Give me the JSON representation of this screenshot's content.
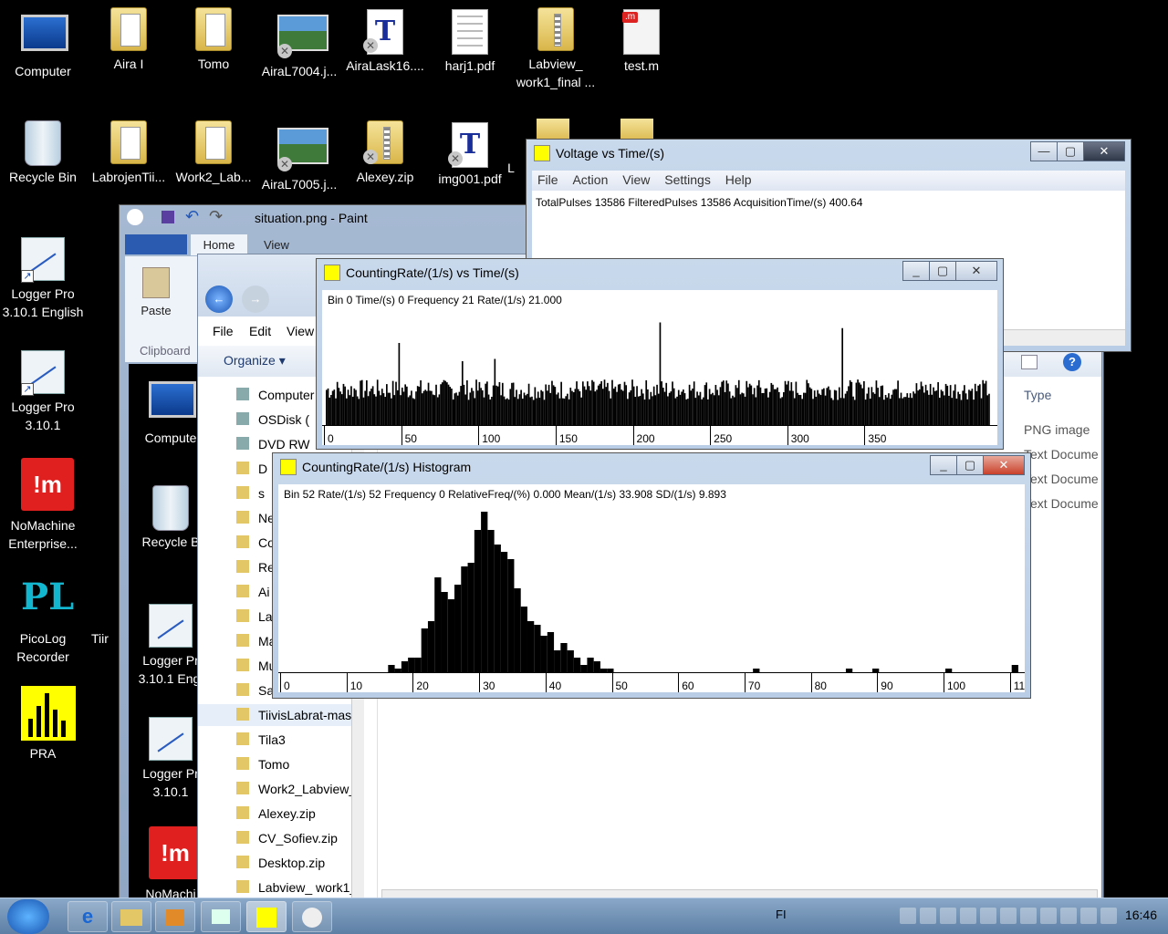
{
  "desktop": {
    "row1": [
      "Computer",
      "Aira I",
      "Tomo",
      "AiraL7004.j...",
      "AiraLask16....",
      "harj1.pdf",
      "Labview_ work1_final ...",
      "test.m"
    ],
    "row2": [
      "Recycle Bin",
      "LabrojenTii...",
      "Work2_Lab...",
      "AiraL7005.j...",
      "Alexey.zip",
      "img001.pdf",
      "L"
    ],
    "left": [
      "Logger Pro 3.10.1 English",
      "Logger Pro 3.10.1",
      "NoMachine Enterprise...",
      "PicoLog Recorder",
      "PRA"
    ],
    "mfile_tag": ".m",
    "nomachine_glyph": "!m",
    "picolog_glyph": "PL"
  },
  "paint": {
    "title": "situation.png - Paint",
    "tabs": [
      "Home",
      "View"
    ],
    "paste": "Paste",
    "clipboard": "Clipboard"
  },
  "explorer": {
    "menu": [
      "File",
      "Edit",
      "View"
    ],
    "organize": "Organize",
    "nav": [
      "Computer",
      "OSDisk (",
      "DVD RW",
      "D",
      "s",
      "Ne",
      "Co",
      "Re",
      "Ai",
      "La",
      "Ma",
      "Mu",
      "Sa",
      "TiivisLabrat-maste",
      "Tila3",
      "Tomo",
      "Work2_Labview_S",
      "Alexey.zip",
      "CV_Sofiev.zip",
      "Desktop.zip",
      "Labview_ work1_f"
    ],
    "type_header": "Type",
    "types": [
      "PNG image",
      "Text Docume",
      "Text Docume",
      "Text Docume"
    ],
    "bg_icons": [
      "Compute",
      "Recycle B",
      "Logger Pr 3.10.1 Engl",
      "Logger Pr 3.10.1",
      "NoMachi",
      "Tiir"
    ]
  },
  "voltage_window": {
    "title": "Voltage vs Time/(s)",
    "menu": [
      "File",
      "Action",
      "View",
      "Settings",
      "Help"
    ],
    "status": "TotalPulses 13586  FilteredPulses 13586  AcquisitionTime/(s) 400.64"
  },
  "rate_window": {
    "title": "CountingRate/(1/s) vs Time/(s)",
    "status": "Bin 0  Time/(s) 0  Frequency 21  Rate/(1/s) 21.000",
    "ticks": [
      "0",
      "50",
      "100",
      "150",
      "200",
      "250",
      "300",
      "350"
    ]
  },
  "hist_window": {
    "title": "CountingRate/(1/s) Histogram",
    "status": "Bin 52  Rate/(1/s) 52  Frequency 0  RelativeFreq/(%) 0.000  Mean/(1/s) 33.908  SD/(1/s) 9.893",
    "ticks": [
      "0",
      "10",
      "20",
      "30",
      "40",
      "50",
      "60",
      "70",
      "80",
      "90",
      "100",
      "11"
    ]
  },
  "taskbar": {
    "lang": "FI",
    "clock": "16:46"
  },
  "chart_data": [
    {
      "type": "bar",
      "title": "CountingRate/(1/s) vs Time/(s)",
      "xlim": [
        0,
        400
      ],
      "spikes": [
        {
          "x": 47,
          "y": 72
        },
        {
          "x": 88,
          "y": 56
        },
        {
          "x": 109,
          "y": 58
        },
        {
          "x": 216,
          "y": 90
        },
        {
          "x": 334,
          "y": 85
        }
      ],
      "baseline_range": [
        22,
        40
      ]
    },
    {
      "type": "bar",
      "title": "CountingRate/(1/s) Histogram",
      "categories": [
        16,
        17,
        18,
        19,
        20,
        21,
        22,
        23,
        24,
        25,
        26,
        27,
        28,
        29,
        30,
        31,
        32,
        33,
        34,
        35,
        36,
        37,
        38,
        39,
        40,
        41,
        42,
        43,
        44,
        45,
        46,
        47,
        48,
        49,
        50,
        71,
        85,
        89,
        100,
        110
      ],
      "values": [
        2,
        1,
        3,
        4,
        4,
        12,
        14,
        26,
        22,
        20,
        24,
        29,
        30,
        39,
        44,
        39,
        35,
        33,
        31,
        23,
        18,
        14,
        13,
        10,
        11,
        6,
        8,
        6,
        4,
        2,
        4,
        3,
        1,
        1,
        0,
        1,
        1,
        1,
        1,
        2
      ],
      "xlim": [
        0,
        110
      ]
    }
  ]
}
